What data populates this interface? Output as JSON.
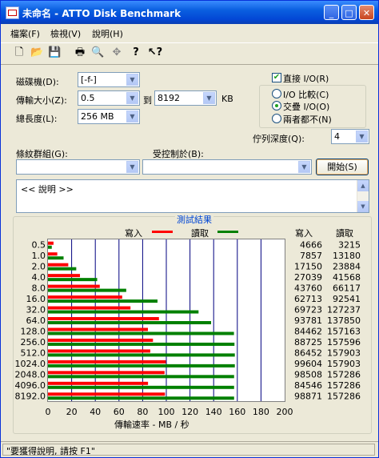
{
  "window": {
    "title": "未命名 - ATTO Disk Benchmark",
    "min_glyph": "_",
    "max_glyph": "□",
    "close_glyph": "✕"
  },
  "menu": [
    "檔案(F)",
    "檢視(V)",
    "說明(H)"
  ],
  "toolbar_icons": [
    "new-file-icon",
    "open-folder-icon",
    "save-icon",
    "print-icon",
    "print-preview-icon",
    "move-icon",
    "help-icon",
    "context-help-icon"
  ],
  "toolbar_glyphs": [
    "🗋",
    "📂",
    "💾",
    "🖶",
    "🔍",
    "✥",
    "?",
    "↖?"
  ],
  "form": {
    "drive_label": "磁碟機(D):",
    "drive_value": "[-f-]",
    "transfer_label": "傳輸大小(Z):",
    "transfer_from": "0.5",
    "to_label": "到",
    "transfer_to": "8192",
    "kb_label": "KB",
    "length_label": "總長度(L):",
    "length_value": "256 MB",
    "direct_io_label": "直接 I/O(R)",
    "direct_io_checked": "✔",
    "io_compare_label": "I/O 比較(C)",
    "overlapped_io_label": "交疊 I/O(O)",
    "neither_label": "兩者都不(N)",
    "queue_label": "佇列深度(Q):",
    "queue_value": "4",
    "pattern_label": "條紋群組(G):",
    "controlled_label": "受控制於(B):",
    "start_button": "開始(S)",
    "description_text": "<< 說明 >>"
  },
  "results": {
    "header": "測試結果",
    "write_legend": "寫入",
    "read_legend": "讀取",
    "write_col": "寫入",
    "read_col": "讀取",
    "xlabel": "傳輸速率 - MB / 秒",
    "write_color": "#ff0000",
    "read_color": "#008000"
  },
  "chart_data": {
    "type": "bar",
    "orientation": "horizontal",
    "categories": [
      "0.5",
      "1.0",
      "2.0",
      "4.0",
      "8.0",
      "16.0",
      "32.0",
      "64.0",
      "128.0",
      "256.0",
      "512.0",
      "1024.0",
      "2048.0",
      "4096.0",
      "8192.0"
    ],
    "series": [
      {
        "name": "寫入",
        "values": [
          4666,
          7857,
          17150,
          27039,
          43760,
          62713,
          69723,
          93781,
          84462,
          88725,
          86452,
          99604,
          98508,
          84546,
          98871
        ]
      },
      {
        "name": "讀取",
        "values": [
          3215,
          13180,
          23884,
          41568,
          66117,
          92541,
          127237,
          137850,
          157163,
          157596,
          157903,
          157903,
          157286,
          157286,
          157286
        ]
      }
    ],
    "xticks": [
      "0",
      "20",
      "40",
      "60",
      "80",
      "100",
      "120",
      "140",
      "160",
      "180",
      "200"
    ],
    "xlim": [
      0,
      200
    ],
    "xlabel": "傳輸速率 - MB / 秒",
    "grid": true,
    "legend": "top"
  },
  "status": {
    "text": "\"要獲得說明, 請按 F1\""
  }
}
